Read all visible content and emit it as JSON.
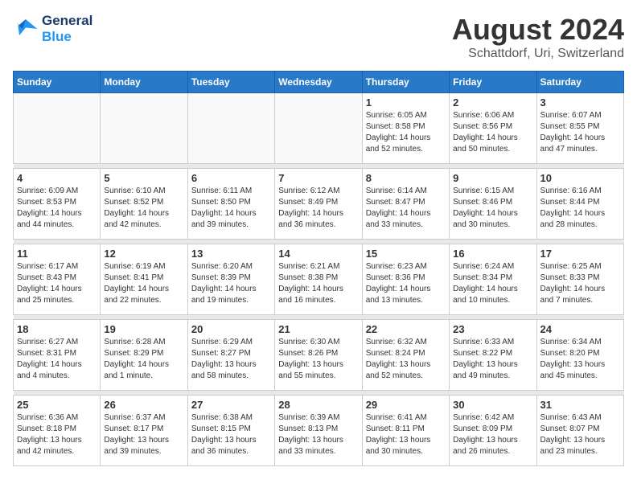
{
  "header": {
    "logo_line1": "General",
    "logo_line2": "Blue",
    "month": "August 2024",
    "location": "Schattdorf, Uri, Switzerland"
  },
  "weekdays": [
    "Sunday",
    "Monday",
    "Tuesday",
    "Wednesday",
    "Thursday",
    "Friday",
    "Saturday"
  ],
  "weeks": [
    [
      {
        "day": "",
        "info": ""
      },
      {
        "day": "",
        "info": ""
      },
      {
        "day": "",
        "info": ""
      },
      {
        "day": "",
        "info": ""
      },
      {
        "day": "1",
        "info": "Sunrise: 6:05 AM\nSunset: 8:58 PM\nDaylight: 14 hours\nand 52 minutes."
      },
      {
        "day": "2",
        "info": "Sunrise: 6:06 AM\nSunset: 8:56 PM\nDaylight: 14 hours\nand 50 minutes."
      },
      {
        "day": "3",
        "info": "Sunrise: 6:07 AM\nSunset: 8:55 PM\nDaylight: 14 hours\nand 47 minutes."
      }
    ],
    [
      {
        "day": "4",
        "info": "Sunrise: 6:09 AM\nSunset: 8:53 PM\nDaylight: 14 hours\nand 44 minutes."
      },
      {
        "day": "5",
        "info": "Sunrise: 6:10 AM\nSunset: 8:52 PM\nDaylight: 14 hours\nand 42 minutes."
      },
      {
        "day": "6",
        "info": "Sunrise: 6:11 AM\nSunset: 8:50 PM\nDaylight: 14 hours\nand 39 minutes."
      },
      {
        "day": "7",
        "info": "Sunrise: 6:12 AM\nSunset: 8:49 PM\nDaylight: 14 hours\nand 36 minutes."
      },
      {
        "day": "8",
        "info": "Sunrise: 6:14 AM\nSunset: 8:47 PM\nDaylight: 14 hours\nand 33 minutes."
      },
      {
        "day": "9",
        "info": "Sunrise: 6:15 AM\nSunset: 8:46 PM\nDaylight: 14 hours\nand 30 minutes."
      },
      {
        "day": "10",
        "info": "Sunrise: 6:16 AM\nSunset: 8:44 PM\nDaylight: 14 hours\nand 28 minutes."
      }
    ],
    [
      {
        "day": "11",
        "info": "Sunrise: 6:17 AM\nSunset: 8:43 PM\nDaylight: 14 hours\nand 25 minutes."
      },
      {
        "day": "12",
        "info": "Sunrise: 6:19 AM\nSunset: 8:41 PM\nDaylight: 14 hours\nand 22 minutes."
      },
      {
        "day": "13",
        "info": "Sunrise: 6:20 AM\nSunset: 8:39 PM\nDaylight: 14 hours\nand 19 minutes."
      },
      {
        "day": "14",
        "info": "Sunrise: 6:21 AM\nSunset: 8:38 PM\nDaylight: 14 hours\nand 16 minutes."
      },
      {
        "day": "15",
        "info": "Sunrise: 6:23 AM\nSunset: 8:36 PM\nDaylight: 14 hours\nand 13 minutes."
      },
      {
        "day": "16",
        "info": "Sunrise: 6:24 AM\nSunset: 8:34 PM\nDaylight: 14 hours\nand 10 minutes."
      },
      {
        "day": "17",
        "info": "Sunrise: 6:25 AM\nSunset: 8:33 PM\nDaylight: 14 hours\nand 7 minutes."
      }
    ],
    [
      {
        "day": "18",
        "info": "Sunrise: 6:27 AM\nSunset: 8:31 PM\nDaylight: 14 hours\nand 4 minutes."
      },
      {
        "day": "19",
        "info": "Sunrise: 6:28 AM\nSunset: 8:29 PM\nDaylight: 14 hours\nand 1 minute."
      },
      {
        "day": "20",
        "info": "Sunrise: 6:29 AM\nSunset: 8:27 PM\nDaylight: 13 hours\nand 58 minutes."
      },
      {
        "day": "21",
        "info": "Sunrise: 6:30 AM\nSunset: 8:26 PM\nDaylight: 13 hours\nand 55 minutes."
      },
      {
        "day": "22",
        "info": "Sunrise: 6:32 AM\nSunset: 8:24 PM\nDaylight: 13 hours\nand 52 minutes."
      },
      {
        "day": "23",
        "info": "Sunrise: 6:33 AM\nSunset: 8:22 PM\nDaylight: 13 hours\nand 49 minutes."
      },
      {
        "day": "24",
        "info": "Sunrise: 6:34 AM\nSunset: 8:20 PM\nDaylight: 13 hours\nand 45 minutes."
      }
    ],
    [
      {
        "day": "25",
        "info": "Sunrise: 6:36 AM\nSunset: 8:18 PM\nDaylight: 13 hours\nand 42 minutes."
      },
      {
        "day": "26",
        "info": "Sunrise: 6:37 AM\nSunset: 8:17 PM\nDaylight: 13 hours\nand 39 minutes."
      },
      {
        "day": "27",
        "info": "Sunrise: 6:38 AM\nSunset: 8:15 PM\nDaylight: 13 hours\nand 36 minutes."
      },
      {
        "day": "28",
        "info": "Sunrise: 6:39 AM\nSunset: 8:13 PM\nDaylight: 13 hours\nand 33 minutes."
      },
      {
        "day": "29",
        "info": "Sunrise: 6:41 AM\nSunset: 8:11 PM\nDaylight: 13 hours\nand 30 minutes."
      },
      {
        "day": "30",
        "info": "Sunrise: 6:42 AM\nSunset: 8:09 PM\nDaylight: 13 hours\nand 26 minutes."
      },
      {
        "day": "31",
        "info": "Sunrise: 6:43 AM\nSunset: 8:07 PM\nDaylight: 13 hours\nand 23 minutes."
      }
    ]
  ]
}
